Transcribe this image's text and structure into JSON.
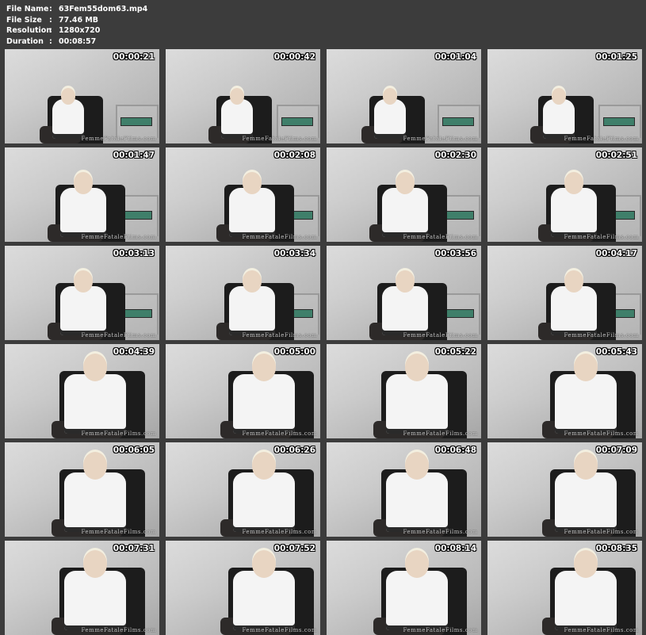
{
  "file_info": {
    "rows": [
      {
        "key": "File Name",
        "sep": ":",
        "value": "63Fem55dom63.mp4"
      },
      {
        "key": "File Size",
        "sep": ":",
        "value": "77.46 MB"
      },
      {
        "key": "Resolution",
        "sep": ":",
        "value": "1280x720"
      },
      {
        "key": "Duration",
        "sep": ":",
        "value": "00:08:57"
      }
    ]
  },
  "watermark": "FemmeFataleFilms.com",
  "thumbnails": [
    {
      "time": "00:00:21"
    },
    {
      "time": "00:00:42"
    },
    {
      "time": "00:01:04"
    },
    {
      "time": "00:01:25"
    },
    {
      "time": "00:01:47"
    },
    {
      "time": "00:02:08"
    },
    {
      "time": "00:02:30"
    },
    {
      "time": "00:02:51"
    },
    {
      "time": "00:03:13"
    },
    {
      "time": "00:03:34"
    },
    {
      "time": "00:03:56"
    },
    {
      "time": "00:04:17"
    },
    {
      "time": "00:04:39"
    },
    {
      "time": "00:05:00"
    },
    {
      "time": "00:05:22"
    },
    {
      "time": "00:05:43"
    },
    {
      "time": "00:06:05"
    },
    {
      "time": "00:06:26"
    },
    {
      "time": "00:06:48"
    },
    {
      "time": "00:07:09"
    },
    {
      "time": "00:07:31"
    },
    {
      "time": "00:07:52"
    },
    {
      "time": "00:08:14"
    },
    {
      "time": "00:08:35"
    }
  ]
}
